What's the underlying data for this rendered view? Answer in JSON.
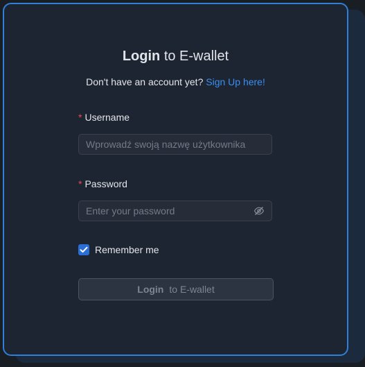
{
  "header": {
    "title_strong": "Login",
    "title_rest": "to E-wallet",
    "subtitle_text": "Don't have an account yet?",
    "signup_link": "Sign Up here!"
  },
  "form": {
    "required_marker": "*",
    "username": {
      "label": "Username",
      "value": "",
      "placeholder": "Wprowadź swoją nazwę użytkownika"
    },
    "password": {
      "label": "Password",
      "value": "",
      "placeholder": "Enter your password",
      "visibility_icon": "eye-slash-icon"
    },
    "remember": {
      "label": "Remember me",
      "checked": true
    },
    "submit": {
      "label_strong": "Login",
      "label_rest": "to E-wallet"
    }
  },
  "colors": {
    "background": "#191e25",
    "card": "#1e2532",
    "card_border": "#2f80d8",
    "link": "#3a8ef0",
    "required": "#e34b4b",
    "checkbox": "#2b6fd6"
  }
}
